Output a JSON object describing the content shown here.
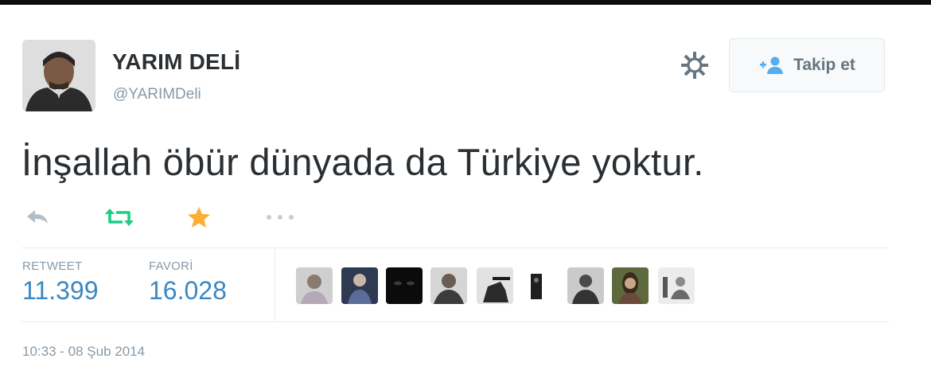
{
  "user": {
    "display_name": "YARIM DELİ",
    "handle": "@YARIMDeli"
  },
  "follow_button": {
    "label": "Takip et",
    "icon": "add-user-icon"
  },
  "tweet": {
    "text": "İnşallah öbür dünyada da Türkiye yoktur."
  },
  "actions": [
    {
      "icon": "reply-icon",
      "color": "#b3bfc8"
    },
    {
      "icon": "retweet-icon",
      "color": "#19cf86"
    },
    {
      "icon": "star-icon",
      "color": "#ffac33"
    },
    {
      "icon": "more-icon",
      "color": "#b3bfc8"
    }
  ],
  "stats": {
    "retweets": {
      "label": "RETWEET",
      "value": "11.399"
    },
    "favorites": {
      "label": "FAVORİ",
      "value": "16.028"
    }
  },
  "timestamp": "10:33 - 08 Şub 2014",
  "colors": {
    "link": "#3b88c3",
    "muted": "#8899a6",
    "text": "#292f33",
    "retweet_green": "#19cf86",
    "favorite_gold": "#ffac33"
  }
}
